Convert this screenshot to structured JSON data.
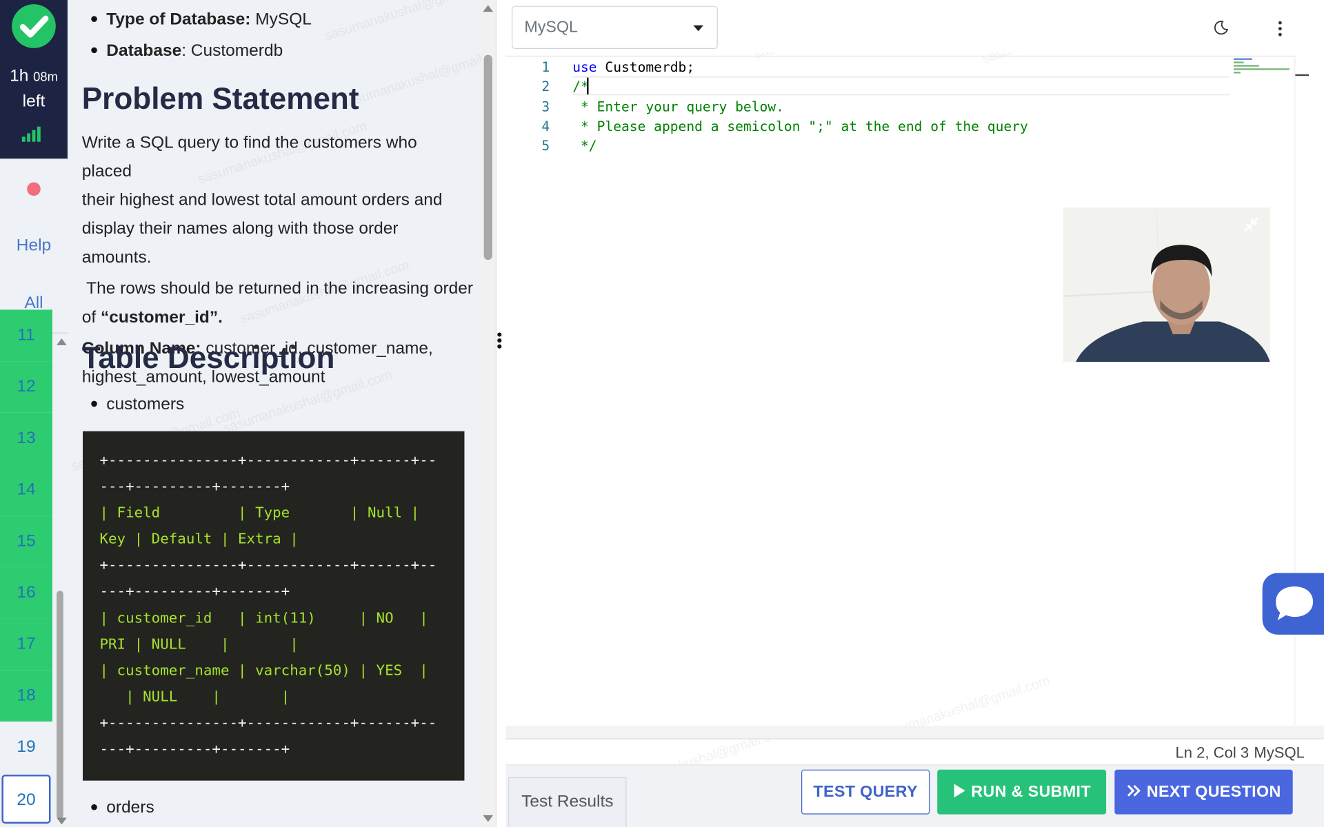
{
  "timer": {
    "hours": "1h",
    "minutes": "08m",
    "label": "left"
  },
  "nav": {
    "help": "Help",
    "all": "All"
  },
  "questions": [
    {
      "num": "11",
      "state": "done"
    },
    {
      "num": "12",
      "state": "done"
    },
    {
      "num": "13",
      "state": "done"
    },
    {
      "num": "14",
      "state": "done"
    },
    {
      "num": "15",
      "state": "done"
    },
    {
      "num": "16",
      "state": "done"
    },
    {
      "num": "17",
      "state": "done"
    },
    {
      "num": "18",
      "state": "done"
    },
    {
      "num": "19",
      "state": "pending"
    },
    {
      "num": "20",
      "state": "current"
    }
  ],
  "problem": {
    "db_type_label": "Type of Database:",
    "db_type": "MySQL",
    "db_label": "Database",
    "db_name": ": Customerdb",
    "heading": "Problem Statement",
    "statement_lines": [
      "Write a SQL query to find the customers who placed",
      "their highest and lowest total amount orders and",
      "display their names along with those order amounts."
    ],
    "order_line": " The rows should be returned in the increasing order",
    "order_of": "of ",
    "order_key": "“customer_id”.",
    "columns_label": "Column Name:",
    "columns_line1": " customer_id, customer_name,",
    "columns_line2": "highest_amount, lowest_amount",
    "table_heading": "Table Description",
    "table1": "customers",
    "table2": "orders",
    "schema_lines": [
      "+---------------+------------+------+--",
      "---+---------+-------+",
      "| Field         | Type       | Null |",
      "Key | Default | Extra |",
      "+---------------+------------+------+--",
      "---+---------+-------+",
      "| customer_id   | int(11)     | NO   |",
      "PRI | NULL    |       |",
      "| customer_name | varchar(50) | YES  |",
      "   | NULL    |       |",
      "+---------------+------------+------+--",
      "---+---------+-------+"
    ]
  },
  "editor": {
    "language_select": "MySQL",
    "lines": [
      {
        "n": "1",
        "kw": "use",
        "rest": " Customerdb;"
      },
      {
        "n": "2",
        "kw": "",
        "rest": "/*"
      },
      {
        "n": "3",
        "kw": "",
        "rest": " * Enter your query below."
      },
      {
        "n": "4",
        "kw": "",
        "rest": " * Please append a semicolon \";\" at the end of the query"
      },
      {
        "n": "5",
        "kw": "",
        "rest": " */"
      }
    ],
    "cursor_pos": "Ln 2, Col 3",
    "language_status": "MySQL"
  },
  "bottom": {
    "tab": "Test Results",
    "test": "TEST QUERY",
    "run": "RUN & SUBMIT",
    "next": "NEXT QUESTION"
  },
  "colors": {
    "accent": "#3f63c7",
    "success": "#2ecc71",
    "run": "#27c27a",
    "next": "#4a67e0",
    "nav_dark": "#1d2342"
  },
  "icons": [
    "check-icon",
    "signal-icon",
    "record-dot-icon",
    "moon-icon",
    "kebab-menu-icon",
    "collapse-icon",
    "play-icon",
    "double-chevron-icon",
    "chat-icon"
  ]
}
